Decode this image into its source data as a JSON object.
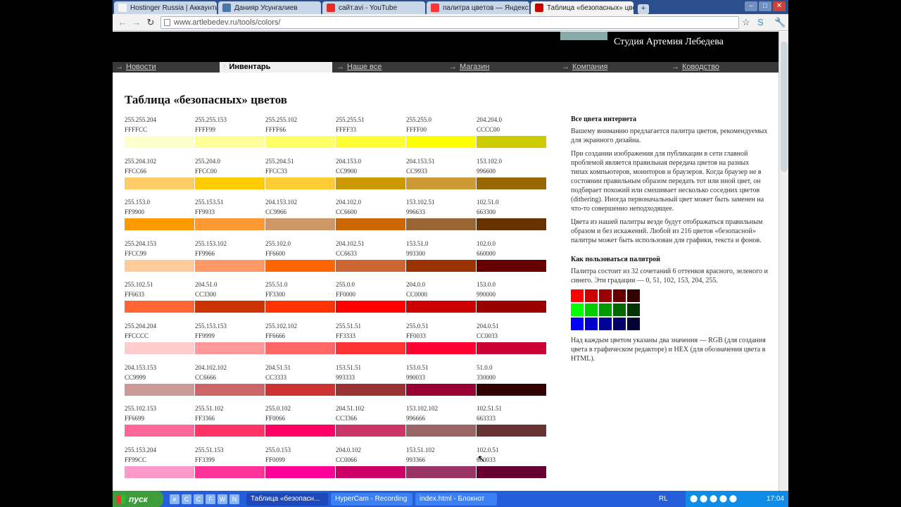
{
  "browser": {
    "tabs": [
      {
        "label": "Hostinger Russia | Аккаунты",
        "icon_color": "#f4f4f4"
      },
      {
        "label": "Данияр Усунгалиев",
        "icon_color": "#4a76a8"
      },
      {
        "label": "сайт.avi - YouTube",
        "icon_color": "#e52d27"
      },
      {
        "label": "палитра цветов — Яндекс: Н",
        "icon_color": "#ff3333"
      },
      {
        "label": "Таблица «безопасных» цвет",
        "icon_color": "#c80000",
        "active": true
      }
    ],
    "new_tab": "+",
    "url": "www.artlebedev.ru/tools/colors/"
  },
  "site": {
    "studio": "Студия Артемия Лебедева",
    "menu": [
      {
        "label": "Новости",
        "arrow": "→"
      },
      {
        "label": "Инвентарь",
        "arrow": "↑",
        "active": true
      },
      {
        "label": "Наше все",
        "arrow": "→"
      },
      {
        "label": "Магазин",
        "arrow": "→"
      },
      {
        "label": "Компания",
        "arrow": "→"
      },
      {
        "label": "Ководство",
        "arrow": "→"
      }
    ]
  },
  "page": {
    "title": "Таблица «безопасных» цветов"
  },
  "palette": [
    [
      {
        "rgb": "255.255.204",
        "hex": "FFFFCC"
      },
      {
        "rgb": "255.255.153",
        "hex": "FFFF99"
      },
      {
        "rgb": "255.255.102",
        "hex": "FFFF66"
      },
      {
        "rgb": "255.255.51",
        "hex": "FFFF33"
      },
      {
        "rgb": "255.255.0",
        "hex": "FFFF00"
      },
      {
        "rgb": "204.204.0",
        "hex": "CCCC00"
      }
    ],
    [
      {
        "rgb": "255.204.102",
        "hex": "FFCC66"
      },
      {
        "rgb": "255.204.0",
        "hex": "FFCC00"
      },
      {
        "rgb": "255.204.51",
        "hex": "FFCC33"
      },
      {
        "rgb": "204.153.0",
        "hex": "CC9900"
      },
      {
        "rgb": "204.153.51",
        "hex": "CC9933"
      },
      {
        "rgb": "153.102.0",
        "hex": "996600"
      }
    ],
    [
      {
        "rgb": "255.153.0",
        "hex": "FF9900"
      },
      {
        "rgb": "255.153.51",
        "hex": "FF9933"
      },
      {
        "rgb": "204.153.102",
        "hex": "CC9966"
      },
      {
        "rgb": "204.102.0",
        "hex": "CC6600"
      },
      {
        "rgb": "153.102.51",
        "hex": "996633"
      },
      {
        "rgb": "102.51.0",
        "hex": "663300"
      }
    ],
    [
      {
        "rgb": "255.204.153",
        "hex": "FFCC99"
      },
      {
        "rgb": "255.153.102",
        "hex": "FF9966"
      },
      {
        "rgb": "255.102.0",
        "hex": "FF6600"
      },
      {
        "rgb": "204.102.51",
        "hex": "CC6633"
      },
      {
        "rgb": "153.51.0",
        "hex": "993300"
      },
      {
        "rgb": "102.0.0",
        "hex": "660000"
      }
    ],
    [
      {
        "rgb": "255.102.51",
        "hex": "FF6633"
      },
      {
        "rgb": "204.51.0",
        "hex": "CC3300"
      },
      {
        "rgb": "255.51.0",
        "hex": "FF3300"
      },
      {
        "rgb": "255.0.0",
        "hex": "FF0000"
      },
      {
        "rgb": "204.0.0",
        "hex": "CC0000"
      },
      {
        "rgb": "153.0.0",
        "hex": "990000"
      }
    ],
    [
      {
        "rgb": "255.204.204",
        "hex": "FFCCCC"
      },
      {
        "rgb": "255.153.153",
        "hex": "FF9999"
      },
      {
        "rgb": "255.102.102",
        "hex": "FF6666"
      },
      {
        "rgb": "255.51.51",
        "hex": "FF3333"
      },
      {
        "rgb": "255.0.51",
        "hex": "FF0033"
      },
      {
        "rgb": "204.0.51",
        "hex": "CC0033"
      }
    ],
    [
      {
        "rgb": "204.153.153",
        "hex": "CC9999"
      },
      {
        "rgb": "204.102.102",
        "hex": "CC6666"
      },
      {
        "rgb": "204.51.51",
        "hex": "CC3333"
      },
      {
        "rgb": "153.51.51",
        "hex": "993333"
      },
      {
        "rgb": "153.0.51",
        "hex": "990033"
      },
      {
        "rgb": "51.0.0",
        "hex": "330000"
      }
    ],
    [
      {
        "rgb": "255.102.153",
        "hex": "FF6699"
      },
      {
        "rgb": "255.51.102",
        "hex": "FF3366"
      },
      {
        "rgb": "255.0.102",
        "hex": "FF0066"
      },
      {
        "rgb": "204.51.102",
        "hex": "CC3366"
      },
      {
        "rgb": "153.102.102",
        "hex": "996666"
      },
      {
        "rgb": "102.51.51",
        "hex": "663333"
      }
    ],
    [
      {
        "rgb": "255.153.204",
        "hex": "FF99CC"
      },
      {
        "rgb": "255.51.153",
        "hex": "FF3399"
      },
      {
        "rgb": "255.0.153",
        "hex": "FF0099"
      },
      {
        "rgb": "204.0.102",
        "hex": "CC0066"
      },
      {
        "rgb": "153.51.102",
        "hex": "993366"
      },
      {
        "rgb": "102.0.51",
        "hex": "660033"
      }
    ]
  ],
  "sidebar": {
    "h1": "Все цвета интернета",
    "p1": "Вашему вниманию предлагается палитра цветов, рекомендуемых для экранного дизайна.",
    "p2": "При создании изображения для публикации в сети главной проблемой является правильная передача цветов на разных типах компьютеров, мониторов и браузеров. Когда браузер не в состоянии правильным образом передать тот или иной цвет, он подбирает похожий или смешивает несколько соседних цветов (dithering). Иногда первоначальный цвет может быть заменен на что-то совершенно неподходящее.",
    "p3": "Цвета из нашей палитры везде будут отображаться правильным образом и без искажений. Любой из 216 цветов «безопасной» палитры может быть использован для графики, текста и фонов.",
    "h2": "Как пользоваться палитрой",
    "p4": "Палитра состоит из 32 сочетаний 6 оттенков красного, зеленого и синего. Эти градации — 0, 51, 102, 153, 204, 255.",
    "swatches": [
      "#ff0000",
      "#cc0000",
      "#990000",
      "#660000",
      "#330000",
      "#00ff00",
      "#00cc00",
      "#009900",
      "#006600",
      "#003300",
      "#0000ff",
      "#0000cc",
      "#000099",
      "#000066",
      "#000033"
    ],
    "p5": "Над каждым цветом указаны два значения — RGB (для создания цвета в графическом редакторе) и HEX (для обозначения цвета в HTML)."
  },
  "taskbar": {
    "start": "пуск",
    "quick": [
      "e",
      "C",
      "C",
      "F",
      "W",
      "N"
    ],
    "tasks": [
      {
        "label": "Таблица «безопасн...",
        "active": true
      },
      {
        "label": "HyperCam - Recording"
      },
      {
        "label": "index.html - Блокнот"
      }
    ],
    "lang": "RL",
    "time": "17:04"
  }
}
